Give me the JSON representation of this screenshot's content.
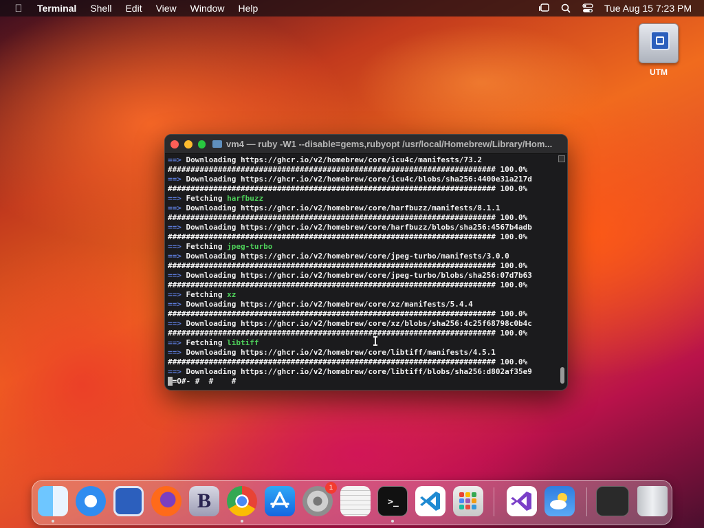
{
  "menubar": {
    "app_name": "Terminal",
    "menus": [
      "Shell",
      "Edit",
      "View",
      "Window",
      "Help"
    ],
    "clock": "Tue Aug 15  7:23 PM"
  },
  "desktop": {
    "icon_label": "UTM"
  },
  "terminal": {
    "title": "vm4 — ruby -W1 --disable=gems,rubyopt /usr/local/Homebrew/Library/Hom...",
    "lines": [
      {
        "arrow": "==>",
        "text": " Downloading https://ghcr.io/v2/homebrew/core/icu4c/manifests/73.2",
        "pkg": ""
      },
      {
        "arrow": "",
        "text": "######################################################################## 100.0%",
        "pkg": ""
      },
      {
        "arrow": "==>",
        "text": " Downloading https://ghcr.io/v2/homebrew/core/icu4c/blobs/sha256:4400e31a217d",
        "pkg": ""
      },
      {
        "arrow": "",
        "text": "######################################################################## 100.0%",
        "pkg": ""
      },
      {
        "arrow": "==>",
        "text": " Fetching ",
        "pkg": "harfbuzz"
      },
      {
        "arrow": "==>",
        "text": " Downloading https://ghcr.io/v2/homebrew/core/harfbuzz/manifests/8.1.1",
        "pkg": ""
      },
      {
        "arrow": "",
        "text": "######################################################################## 100.0%",
        "pkg": ""
      },
      {
        "arrow": "==>",
        "text": " Downloading https://ghcr.io/v2/homebrew/core/harfbuzz/blobs/sha256:4567b4adb",
        "pkg": ""
      },
      {
        "arrow": "",
        "text": "######################################################################## 100.0%",
        "pkg": ""
      },
      {
        "arrow": "==>",
        "text": " Fetching ",
        "pkg": "jpeg-turbo"
      },
      {
        "arrow": "==>",
        "text": " Downloading https://ghcr.io/v2/homebrew/core/jpeg-turbo/manifests/3.0.0",
        "pkg": ""
      },
      {
        "arrow": "",
        "text": "######################################################################## 100.0%",
        "pkg": ""
      },
      {
        "arrow": "==>",
        "text": " Downloading https://ghcr.io/v2/homebrew/core/jpeg-turbo/blobs/sha256:07d7b63",
        "pkg": ""
      },
      {
        "arrow": "",
        "text": "######################################################################## 100.0%",
        "pkg": ""
      },
      {
        "arrow": "==>",
        "text": " Fetching ",
        "pkg": "xz"
      },
      {
        "arrow": "==>",
        "text": " Downloading https://ghcr.io/v2/homebrew/core/xz/manifests/5.4.4",
        "pkg": ""
      },
      {
        "arrow": "",
        "text": "######################################################################## 100.0%",
        "pkg": ""
      },
      {
        "arrow": "==>",
        "text": " Downloading https://ghcr.io/v2/homebrew/core/xz/blobs/sha256:4c25f68798c0b4c",
        "pkg": ""
      },
      {
        "arrow": "",
        "text": "######################################################################## 100.0%",
        "pkg": ""
      },
      {
        "arrow": "==>",
        "text": " Fetching ",
        "pkg": "libtiff"
      },
      {
        "arrow": "==>",
        "text": " Downloading https://ghcr.io/v2/homebrew/core/libtiff/manifests/4.5.1",
        "pkg": ""
      },
      {
        "arrow": "",
        "text": "######################################################################## 100.0%",
        "pkg": ""
      },
      {
        "arrow": "==>",
        "text": " Downloading https://ghcr.io/v2/homebrew/core/libtiff/blobs/sha256:d802af35e9",
        "pkg": ""
      }
    ],
    "progress_line": "=O#- #  #    #",
    "colors": {
      "arrow": "#5b7ad6",
      "package": "#4ed15a",
      "text": "#f2f2f2",
      "background": "#1b1b1d"
    }
  },
  "dock": {
    "items": [
      {
        "icon": "finder-icon",
        "running": true
      },
      {
        "icon": "safari-icon",
        "running": false
      },
      {
        "icon": "utm-icon",
        "running": false
      },
      {
        "icon": "firefox-icon",
        "running": false
      },
      {
        "icon": "bbedit-icon",
        "glyph": "B",
        "running": false
      },
      {
        "icon": "chrome-icon",
        "running": true
      },
      {
        "icon": "app-store-icon",
        "running": false
      },
      {
        "icon": "system-settings-icon",
        "badge": "1",
        "running": false
      },
      {
        "icon": "textedit-icon",
        "running": false
      },
      {
        "icon": "terminal-icon",
        "glyph": ">_",
        "running": true
      },
      {
        "icon": "vscode-icon",
        "running": false
      },
      {
        "icon": "launchpad-icon",
        "running": false
      },
      {
        "icon": "visual-studio-icon",
        "running": false
      },
      {
        "icon": "weather-icon",
        "running": false
      },
      {
        "icon": "chrome-window-thumbnail",
        "running": false
      },
      {
        "icon": "trash-icon",
        "running": false
      }
    ]
  }
}
